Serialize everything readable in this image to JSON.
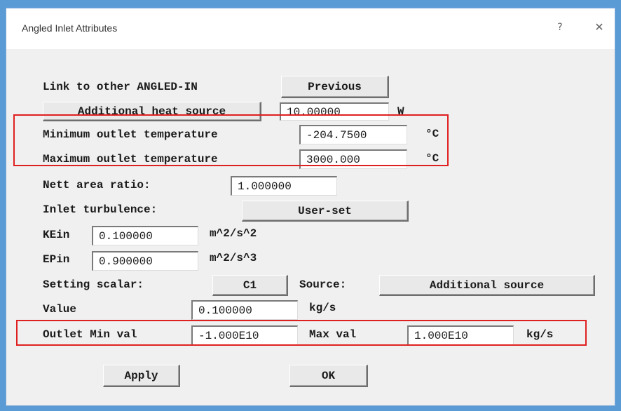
{
  "window": {
    "title": "Angled Inlet Attributes",
    "help_label": "?",
    "close_label": "✕"
  },
  "link": {
    "label": "Link to other ANGLED-IN",
    "button": "Previous"
  },
  "heat": {
    "button": "Additional heat source",
    "value": "10.00000",
    "unit": "W"
  },
  "min_temp": {
    "label": "Minimum outlet temperature",
    "value": "-204.7500",
    "unit": "°C"
  },
  "max_temp": {
    "label": "Maximum outlet temperature",
    "value": "3000.000",
    "unit": "°C"
  },
  "area": {
    "label": "Nett area ratio:",
    "value": "1.000000"
  },
  "turbulence": {
    "label": "Inlet turbulence:",
    "button": "User-set"
  },
  "kein": {
    "label": "KEin",
    "value": "0.100000",
    "unit": "m^2/s^2"
  },
  "epin": {
    "label": "EPin",
    "value": "0.900000",
    "unit": "m^2/s^3"
  },
  "scalar": {
    "label": "Setting scalar:",
    "button": "C1",
    "source_label": "Source:",
    "source_button": "Additional source"
  },
  "value_row": {
    "label": "Value",
    "value": "0.100000",
    "unit": "kg/s"
  },
  "outlet": {
    "min_label": "Outlet Min val",
    "min_value": "-1.000E10",
    "max_label": "Max val",
    "max_value": "1.000E10",
    "unit": "kg/s"
  },
  "actions": {
    "apply": "Apply",
    "ok": "OK"
  },
  "colors": {
    "highlight": "#e02020",
    "frame": "#5b9bd5"
  }
}
